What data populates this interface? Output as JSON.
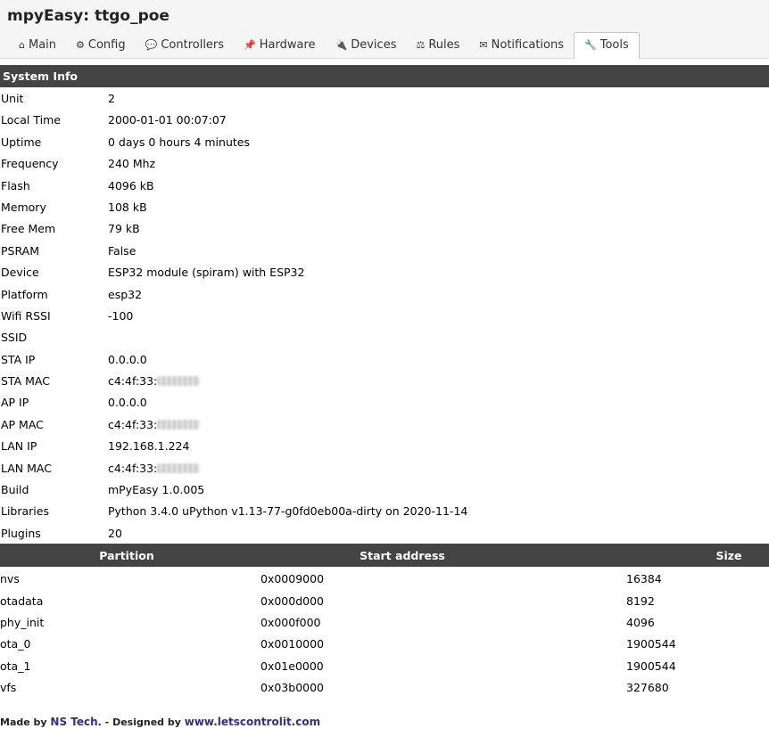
{
  "app": {
    "title": "mpyEasy: ttgo_poe"
  },
  "tabs": [
    {
      "label": "Main",
      "icon": "⌂"
    },
    {
      "label": "Config",
      "icon": "⚙"
    },
    {
      "label": "Controllers",
      "icon": "💬"
    },
    {
      "label": "Hardware",
      "icon": "📌"
    },
    {
      "label": "Devices",
      "icon": "🔌"
    },
    {
      "label": "Rules",
      "icon": "⚖"
    },
    {
      "label": "Notifications",
      "icon": "✉"
    },
    {
      "label": "Tools",
      "icon": "🔧"
    }
  ],
  "active_tab": "Tools",
  "sysinfo": {
    "heading": "System Info",
    "rows": [
      {
        "key": "Unit",
        "value": "2"
      },
      {
        "key": "Local Time",
        "value": "2000-01-01 00:07:07"
      },
      {
        "key": "Uptime",
        "value": "0 days 0 hours 4 minutes"
      },
      {
        "key": "Frequency",
        "value": "240 Mhz"
      },
      {
        "key": "Flash",
        "value": "4096 kB"
      },
      {
        "key": "Memory",
        "value": "108 kB"
      },
      {
        "key": "Free Mem",
        "value": "79 kB"
      },
      {
        "key": "PSRAM",
        "value": "False"
      },
      {
        "key": "Device",
        "value": "ESP32 module (spiram) with ESP32"
      },
      {
        "key": "Platform",
        "value": "esp32"
      },
      {
        "key": "Wifi RSSI",
        "value": "-100"
      },
      {
        "key": "SSID",
        "value": ""
      },
      {
        "key": "STA IP",
        "value": "0.0.0.0"
      },
      {
        "key": "STA MAC",
        "value": "c4:4f:33:",
        "blurred": true
      },
      {
        "key": "AP IP",
        "value": "0.0.0.0"
      },
      {
        "key": "AP MAC",
        "value": "c4:4f:33:",
        "blurred": true
      },
      {
        "key": "LAN IP",
        "value": "192.168.1.224"
      },
      {
        "key": "LAN MAC",
        "value": "c4:4f:33:",
        "blurred": true
      },
      {
        "key": "Build",
        "value": "mPyEasy 1.0.005"
      },
      {
        "key": "Libraries",
        "value": "Python 3.4.0 uPython v1.13-77-g0fd0eb00a-dirty on 2020-11-14"
      },
      {
        "key": "Plugins",
        "value": "20"
      }
    ]
  },
  "partitions": {
    "headers": [
      "Partition",
      "Start address",
      "Size"
    ],
    "rows": [
      [
        "nvs",
        "0x0009000",
        "16384"
      ],
      [
        "otadata",
        "0x000d000",
        "8192"
      ],
      [
        "phy_init",
        "0x000f000",
        "4096"
      ],
      [
        "ota_0",
        "0x0010000",
        "1900544"
      ],
      [
        "ota_1",
        "0x01e0000",
        "1900544"
      ],
      [
        "vfs",
        "0x03b0000",
        "327680"
      ]
    ]
  },
  "footer": {
    "made_by": "Made by ",
    "author": "NS Tech",
    "designed_by": ". - Designed by ",
    "designer": "www.letscontrolit.com"
  }
}
